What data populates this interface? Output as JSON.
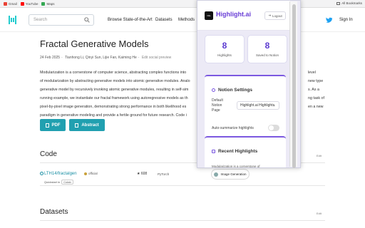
{
  "bookmarks": {
    "items": [
      {
        "label": "Gmail",
        "color": "#ea4335"
      },
      {
        "label": "YouTube",
        "color": "#ff0000"
      },
      {
        "label": "Maps",
        "color": "#34a853"
      }
    ],
    "all_bookmarks": "All Bookmarks"
  },
  "navbar": {
    "search_placeholder": "Search",
    "links": [
      "Browse State-of-the-Art",
      "Datasets",
      "Methods"
    ],
    "sign_in": "Sign In",
    "brand_color": "#21cbce"
  },
  "paper": {
    "title": "Fractal Generative Models",
    "date": "24 Feb 2025",
    "authors": "Tianhong Li, Qinyi Sun, Lijie Fan, Kaiming He",
    "edit_social": "Edit social preview",
    "abstract_lines": [
      "Modularization is a cornerstone of computer science, abstracting complex functions into",
      "of modularization by abstracting generative models into atomic generative modules. Analo",
      "generative model by recursively invoking atomic generative modules, resulting in self-sim",
      "running example, we instantiate our fractal framework using autoregressive models as th",
      "pixel-by-pixel image generation, demonstrating strong performance in both likelihood es",
      "paradigm in generative modeling and provide a fertile ground for future research. Code i"
    ],
    "abstract_right": [
      "level",
      "new type",
      "s. As a",
      "ng task of",
      "en a new",
      ""
    ],
    "pdf_label": "PDF",
    "abstract_label": "Abstract"
  },
  "code": {
    "heading": "Code",
    "edit": "Edit",
    "repo": "LTH14/fractalgen",
    "official": "official",
    "quickstart": "Quickstart in",
    "colab": "Colab",
    "stars": "608",
    "framework": "PyTorch",
    "task": "Image Generation"
  },
  "datasets": {
    "heading": "Datasets",
    "edit": "Edit"
  },
  "extension": {
    "logo_text": "hilite",
    "title": "Highlight.ai",
    "logout": "Logout",
    "accent": "#6a3fd6",
    "stats": [
      {
        "value": "8",
        "label": "Highlights"
      },
      {
        "value": "8",
        "label": "Saved to Notion"
      }
    ],
    "notion": {
      "heading": "Notion Settings",
      "default_page_label": [
        "Default",
        "Notion",
        "Page"
      ],
      "default_page_value": "Highlight.ai Highlights",
      "auto_summarize_label": "Auto-summarize highlights",
      "auto_summarize_on": false
    },
    "recent": {
      "heading": "Recent Highlights",
      "preview": "Modularization is a cornerstone of"
    }
  }
}
